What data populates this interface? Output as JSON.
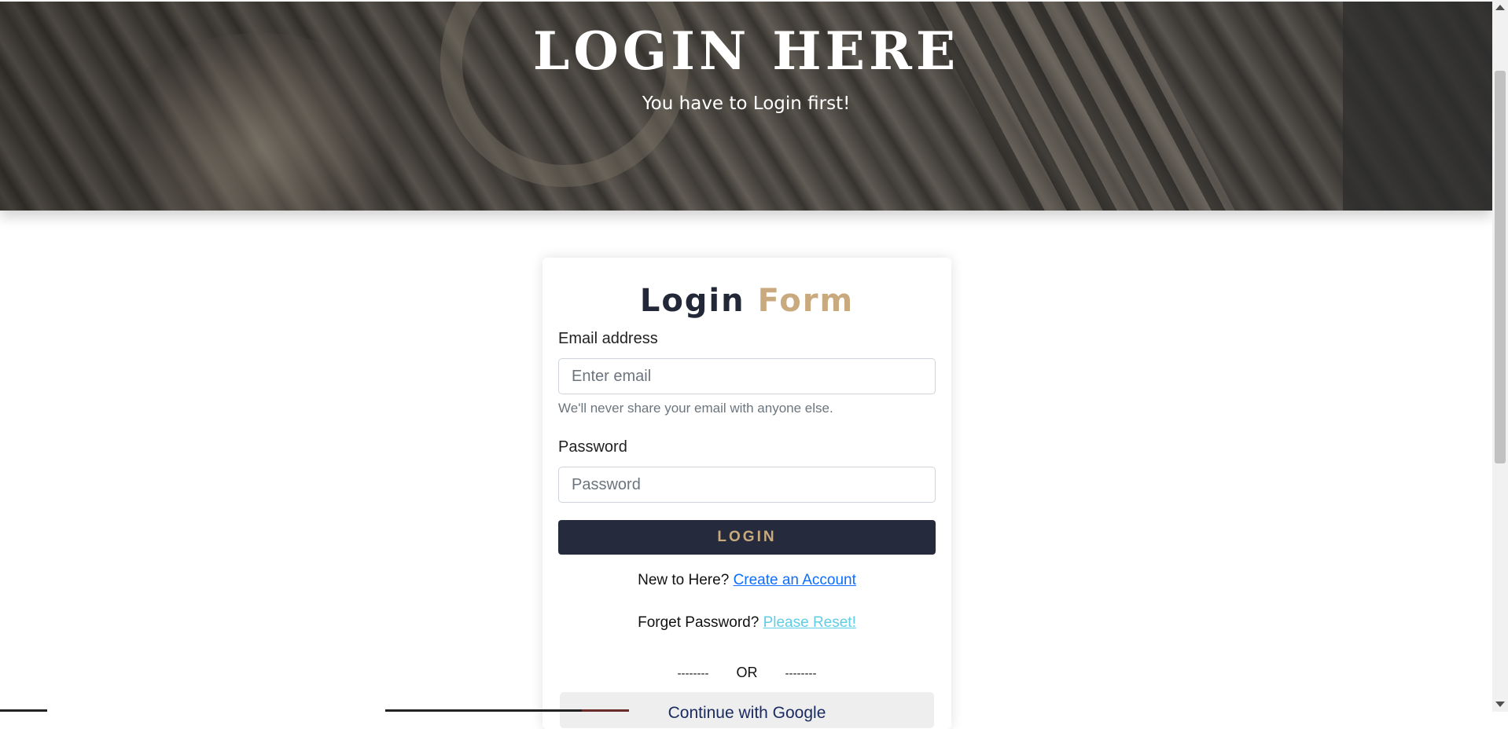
{
  "hero": {
    "title": "LOGIN HERE",
    "subtitle": "You have to Login first!"
  },
  "form": {
    "title_part1": "Login",
    "title_part2": "Form",
    "email": {
      "label": "Email address",
      "placeholder": "Enter email",
      "value": "",
      "help": "We'll never share your email with anyone else."
    },
    "password": {
      "label": "Password",
      "placeholder": "Password",
      "value": ""
    },
    "login_button": "LOGIN",
    "register": {
      "prompt": "New to Here?",
      "link": "Create an Account"
    },
    "reset": {
      "prompt": "Forget Password?",
      "link": "Please Reset!"
    },
    "divider": {
      "left": "--------",
      "text": "OR",
      "right": "--------"
    },
    "google_button": "Continue with Google"
  },
  "colors": {
    "navy": "#252a3c",
    "gold": "#c8aa7e",
    "link_blue": "#0d6efd",
    "link_cyan": "#5ecde6"
  }
}
